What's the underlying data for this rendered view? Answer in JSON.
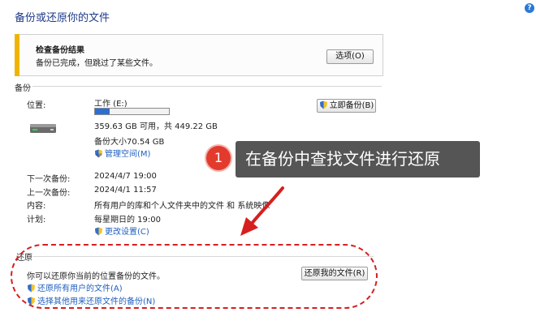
{
  "window": {
    "title": "备份或还原你的文件"
  },
  "notice": {
    "title": "检查备份结果",
    "text": "备份已完成，但跳过了某些文件。",
    "options_button": "选项(O)"
  },
  "backup": {
    "section_label": "备份",
    "location_label": "位置:",
    "drive_name": "工作 (E:)",
    "drive_usage_fraction": 0.2,
    "drive_space": "359.63 GB 可用，共 449.22 GB",
    "backup_size": "备份大小70.54 GB",
    "manage_space_link": "管理空间(M)",
    "backup_now_button": "立即备份(B)",
    "next_backup_label": "下一次备份:",
    "next_backup_value": "2024/4/7 19:00",
    "last_backup_label": "上一次备份:",
    "last_backup_value": "2024/4/1 11:57",
    "contents_label": "内容:",
    "contents_value": "所有用户的库和个人文件夹中的文件 和 系统映像",
    "schedule_label": "计划:",
    "schedule_value": "每星期日的 19:00",
    "change_settings_link": "更改设置(C)"
  },
  "restore": {
    "section_label": "还原",
    "description": "你可以还原你当前的位置备份的文件。",
    "restore_my_files_button": "还原我的文件(R)",
    "restore_all_users_link": "还原所有用户的文件(A)",
    "select_other_backup_link": "选择其他用来还原文件的备份(N)"
  },
  "annotation": {
    "step_number": "1",
    "callout_text": "在备份中查找文件进行还原",
    "highlight_color": "#d61f1f"
  },
  "icons": {
    "help": "help-icon",
    "drive": "hard-drive-icon",
    "shield": "uac-shield-icon"
  }
}
